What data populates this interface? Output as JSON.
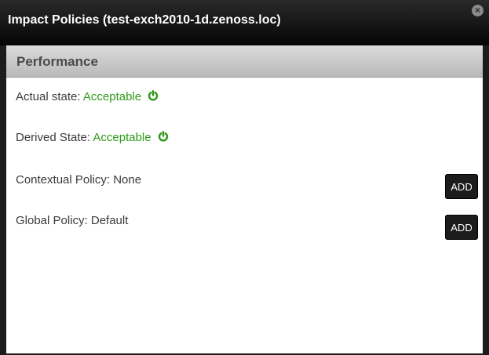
{
  "window": {
    "title": "Impact Policies (test-exch2010-1d.zenoss.loc)",
    "close_glyph": "×"
  },
  "section": {
    "title": "Performance"
  },
  "actual_state": {
    "label": "Actual state: ",
    "value": "Acceptable",
    "icon": "power-icon"
  },
  "derived_state": {
    "label": "Derived State: ",
    "value": "Acceptable",
    "icon": "power-icon"
  },
  "contextual_policy": {
    "label": "Contextual Policy: None",
    "button_label": "ADD"
  },
  "global_policy": {
    "label": "Global Policy: Default",
    "button_label": "ADD"
  },
  "colors": {
    "accent_green": "#2e9a17",
    "titlebar": "#1c1c1c"
  }
}
